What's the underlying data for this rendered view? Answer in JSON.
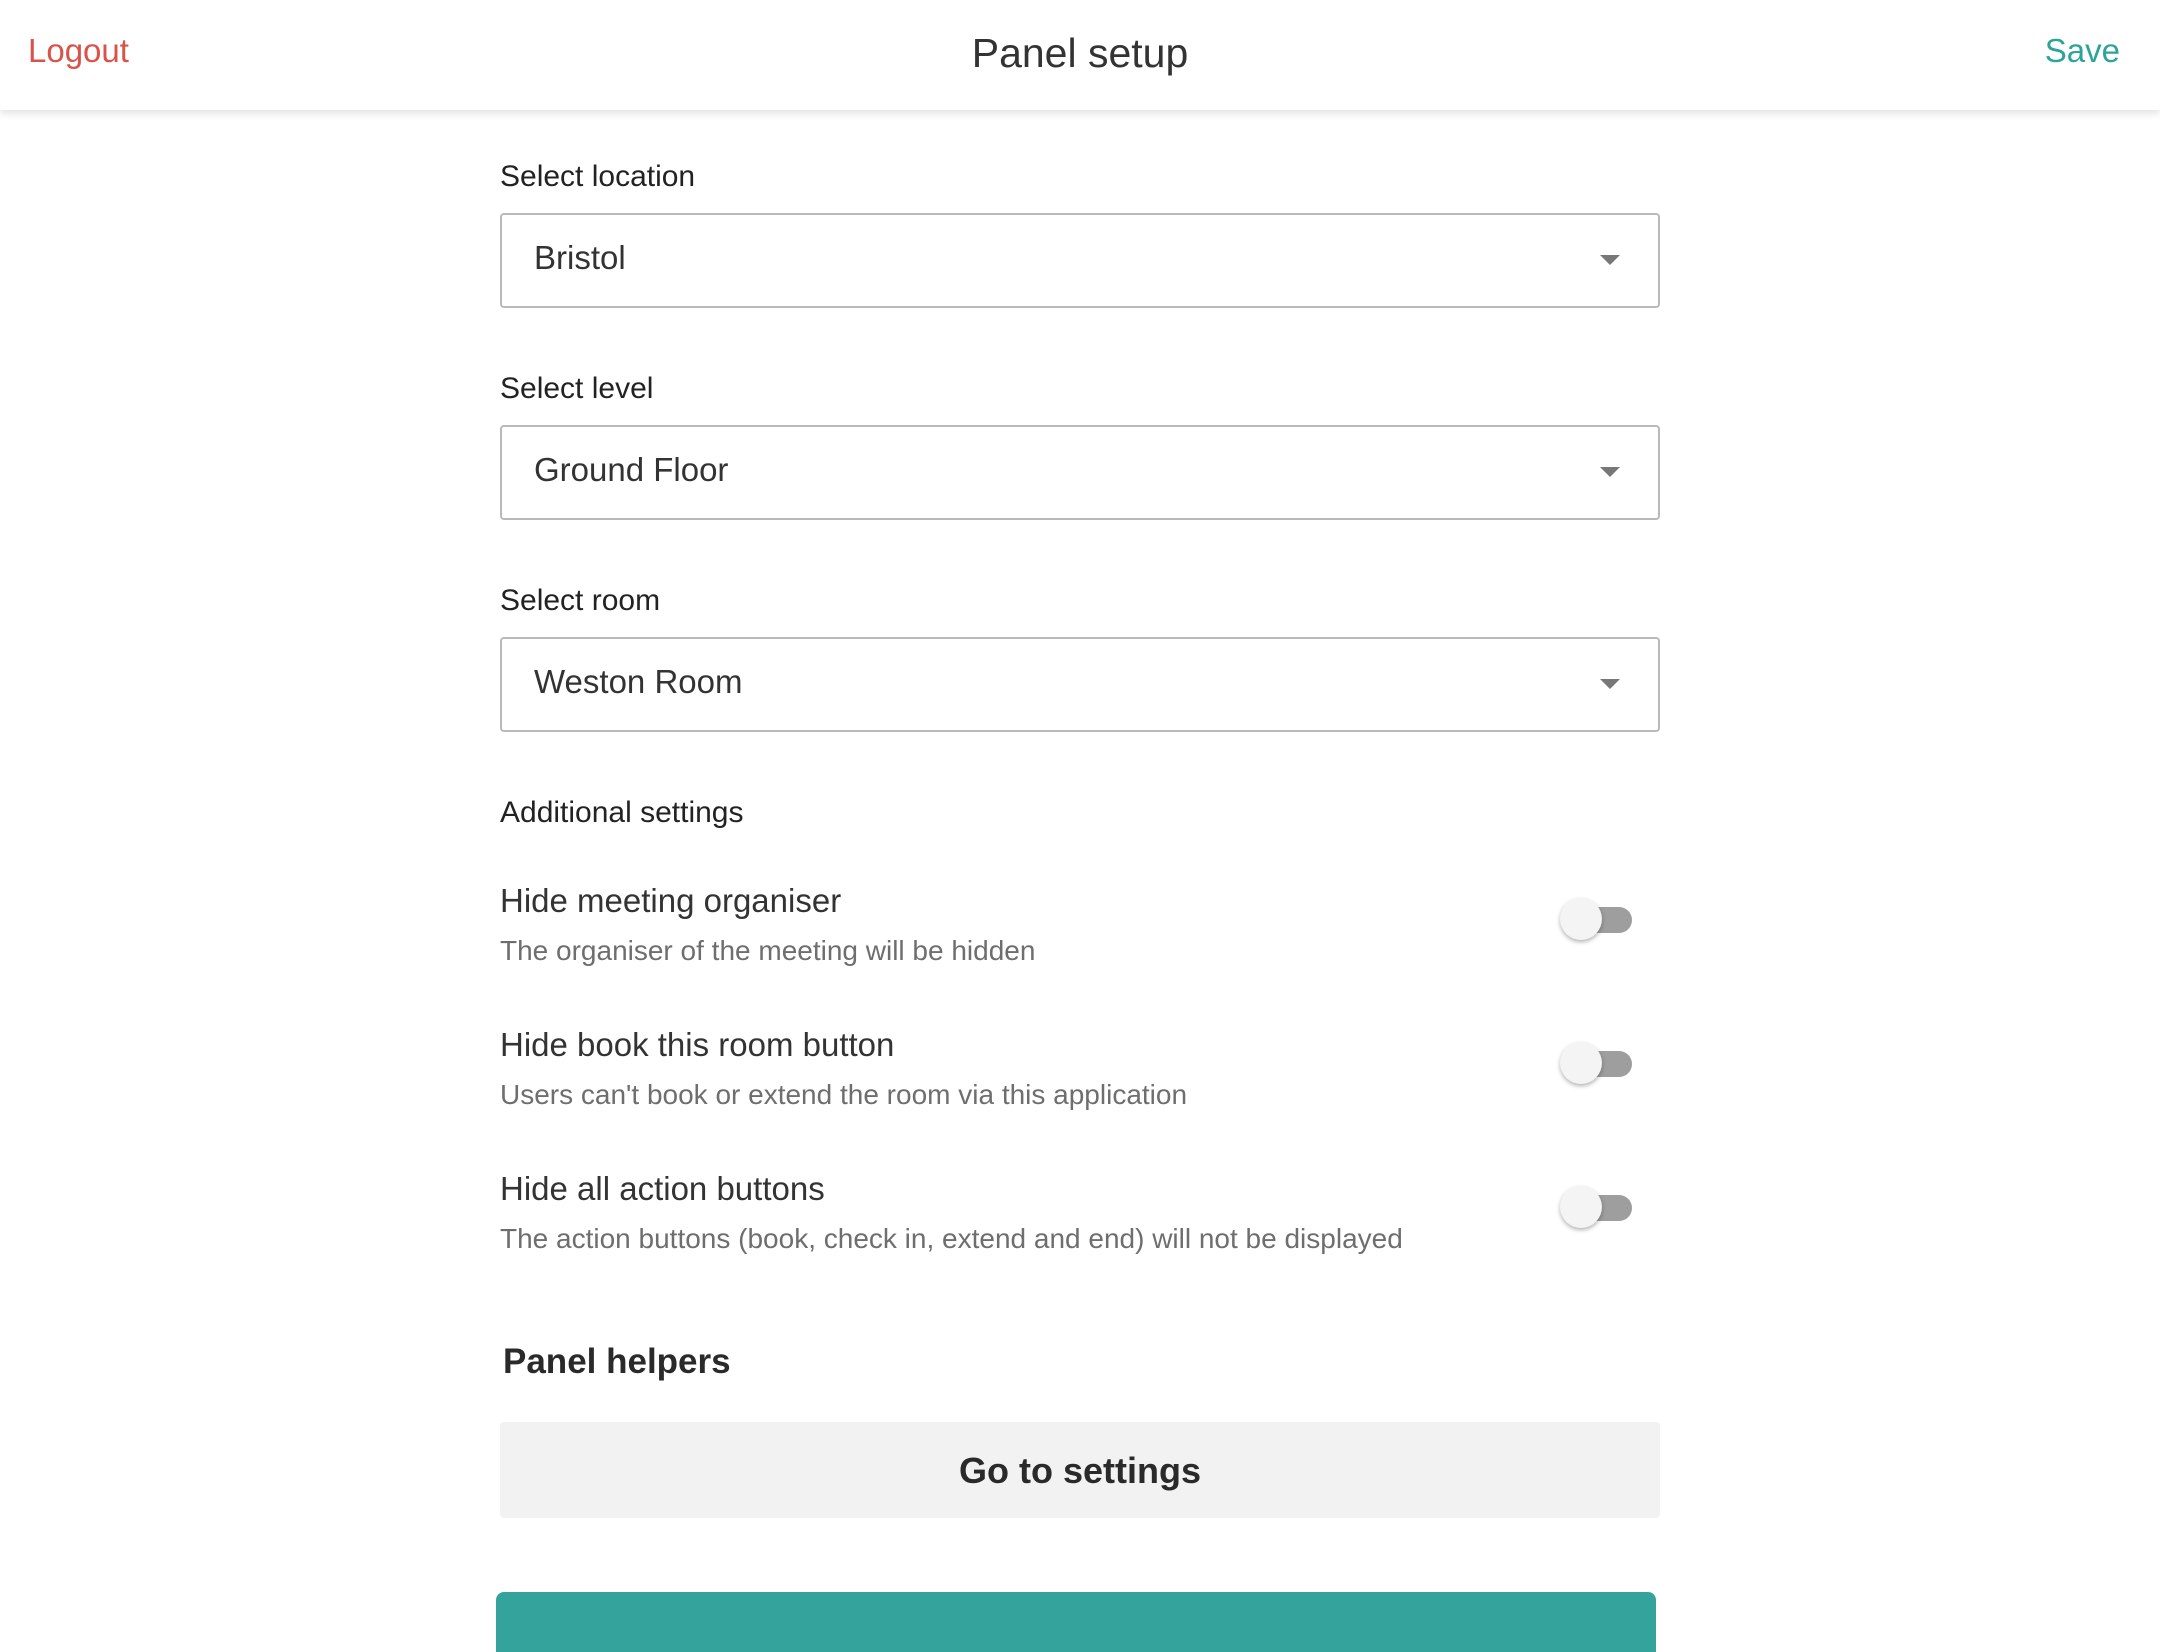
{
  "header": {
    "logout_label": "Logout",
    "title": "Panel setup",
    "save_label": "Save"
  },
  "fields": {
    "location": {
      "label": "Select location",
      "value": "Bristol"
    },
    "level": {
      "label": "Select level",
      "value": "Ground Floor"
    },
    "room": {
      "label": "Select room",
      "value": "Weston Room"
    }
  },
  "additional": {
    "heading": "Additional settings",
    "items": [
      {
        "title": "Hide meeting organiser",
        "description": "The organiser of the meeting will be hidden",
        "enabled": false
      },
      {
        "title": "Hide book this room button",
        "description": "Users can't book or extend the room via this application",
        "enabled": false
      },
      {
        "title": "Hide all action buttons",
        "description": "The action buttons (book, check in, extend and end) will not be displayed",
        "enabled": false
      }
    ]
  },
  "helpers": {
    "heading": "Panel helpers",
    "settings_button_label": "Go to settings"
  },
  "colors": {
    "accent": "#33a39b",
    "logout": "#d9534a",
    "toggle_off": "#9e9e9e"
  }
}
